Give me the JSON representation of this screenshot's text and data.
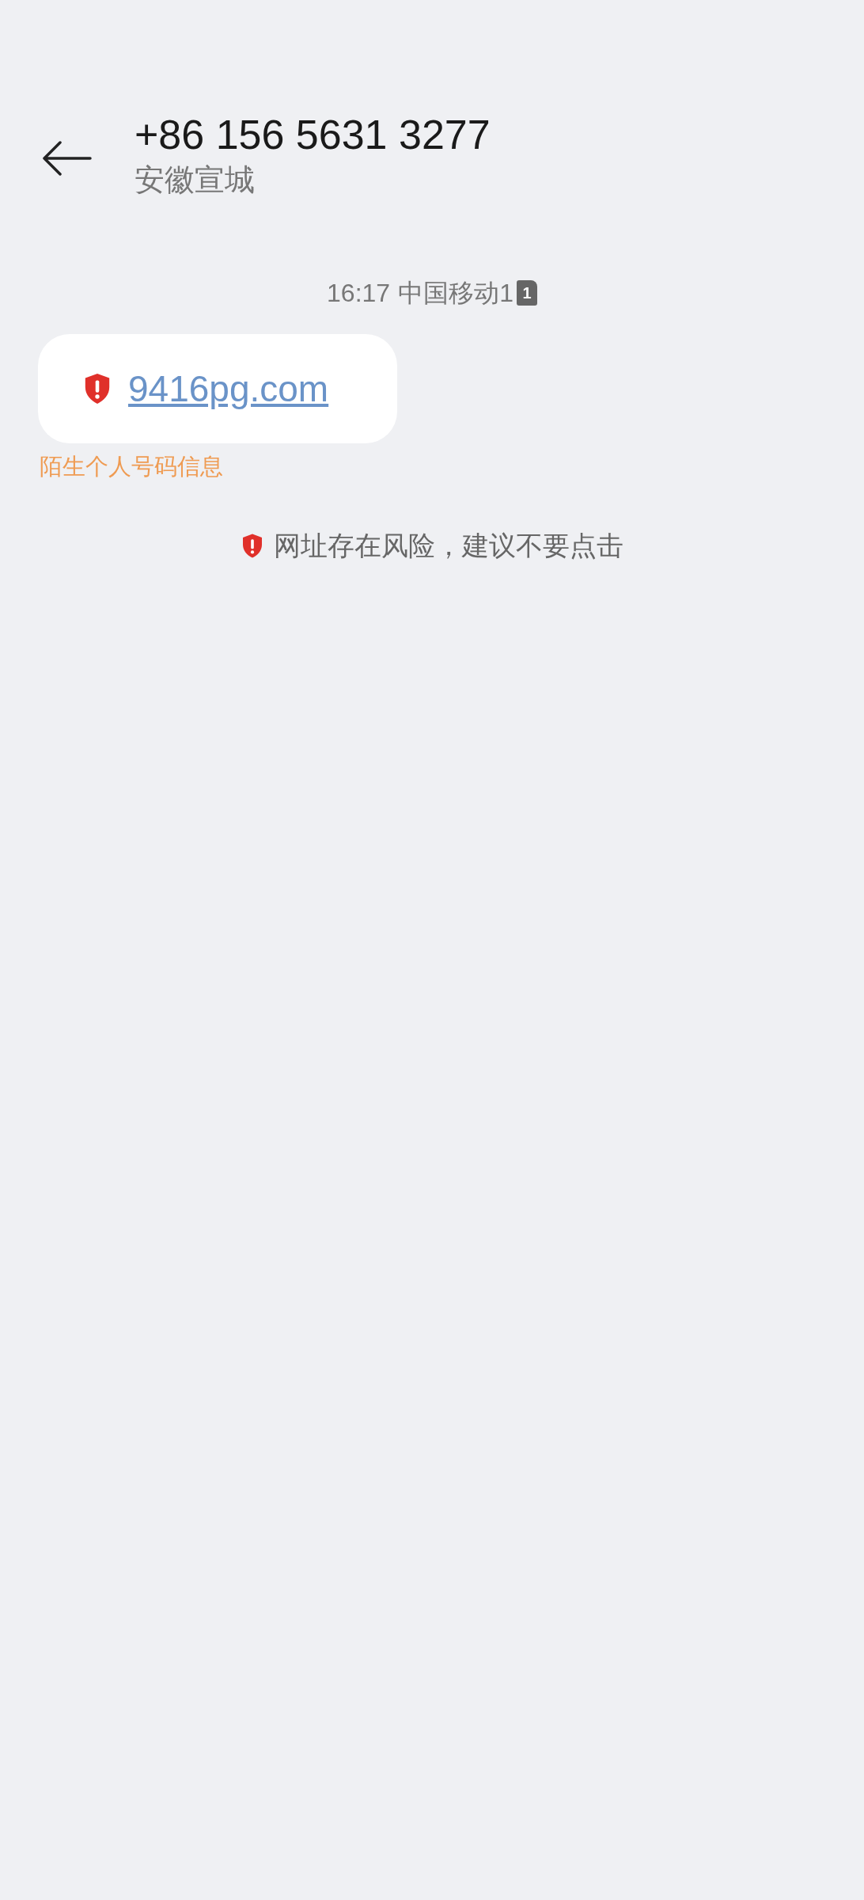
{
  "header": {
    "title": "+86 156 5631 3277",
    "subtitle": "安徽宣城"
  },
  "messages": [
    {
      "time": "16:17",
      "carrier": "中国移动1",
      "sim": "1",
      "link": "9416pg.com",
      "risky": true,
      "tag": "陌生个人号码信息"
    }
  ],
  "warning": {
    "text": "网址存在风险，建议不要点击"
  }
}
